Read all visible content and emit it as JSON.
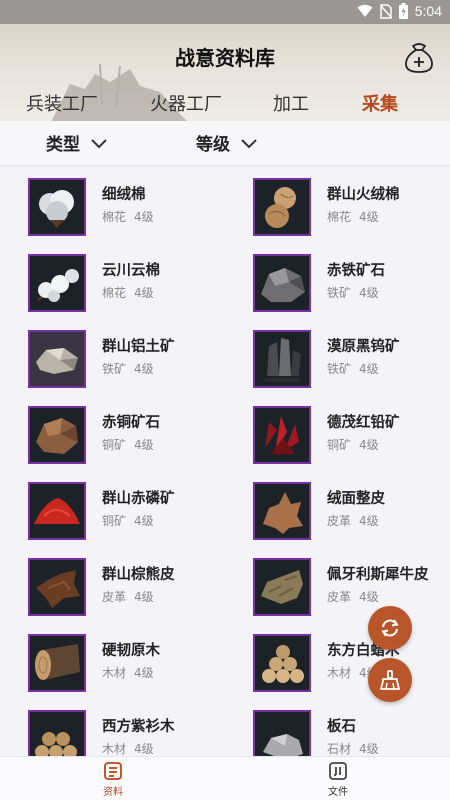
{
  "status_bar": {
    "time": "5:04"
  },
  "header": {
    "title": "战意资料库"
  },
  "tabs": [
    {
      "label": "兵装工厂",
      "active": false
    },
    {
      "label": "火器工厂",
      "active": false
    },
    {
      "label": "加工",
      "active": false
    },
    {
      "label": "采集",
      "active": true
    }
  ],
  "filters": [
    {
      "label": "类型"
    },
    {
      "label": "等级"
    }
  ],
  "items": [
    {
      "name": "细绒棉",
      "category": "棉花",
      "level": "4级",
      "icon": "cotton-boll-icon"
    },
    {
      "name": "群山火绒棉",
      "category": "棉花",
      "level": "4级",
      "icon": "cotton-balls-icon"
    },
    {
      "name": "云川云棉",
      "category": "棉花",
      "level": "4级",
      "icon": "cotton-branch-icon"
    },
    {
      "name": "赤铁矿石",
      "category": "铁矿",
      "level": "4级",
      "icon": "hematite-ore-icon"
    },
    {
      "name": "群山铝土矿",
      "category": "铁矿",
      "level": "4级",
      "icon": "bauxite-ore-icon"
    },
    {
      "name": "漠原黑钨矿",
      "category": "铁矿",
      "level": "4级",
      "icon": "wolframite-ore-icon"
    },
    {
      "name": "赤铜矿石",
      "category": "铜矿",
      "level": "4级",
      "icon": "copper-ore-icon"
    },
    {
      "name": "德茂红铅矿",
      "category": "铜矿",
      "level": "4级",
      "icon": "crocoite-crystal-icon"
    },
    {
      "name": "群山赤磷矿",
      "category": "铜矿",
      "level": "4级",
      "icon": "red-phosphorus-icon"
    },
    {
      "name": "绒面整皮",
      "category": "皮革",
      "level": "4级",
      "icon": "suede-hide-icon"
    },
    {
      "name": "群山棕熊皮",
      "category": "皮革",
      "level": "4级",
      "icon": "bear-hide-icon"
    },
    {
      "name": "佩牙利斯犀牛皮",
      "category": "皮革",
      "level": "4级",
      "icon": "rhino-hide-icon"
    },
    {
      "name": "硬韧原木",
      "category": "木材",
      "level": "4级",
      "icon": "hard-log-icon"
    },
    {
      "name": "东方白蜡木",
      "category": "木材",
      "level": "4级",
      "icon": "ash-wood-icon"
    },
    {
      "name": "西方紫衫木",
      "category": "木材",
      "level": "4级",
      "icon": "yew-wood-icon"
    },
    {
      "name": "板石",
      "category": "石材",
      "level": "4级",
      "icon": "slate-stone-icon"
    }
  ],
  "bottom_nav": [
    {
      "label": "资料",
      "active": true,
      "icon": "document-list-icon"
    },
    {
      "label": "文件",
      "active": false,
      "icon": "files-icon"
    }
  ],
  "colors": {
    "accent": "#b5481c",
    "fab": "#b8552a",
    "thumb_border": "#7b2fa5"
  }
}
